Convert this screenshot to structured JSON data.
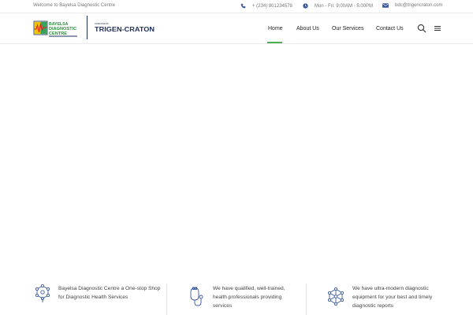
{
  "topbar": {
    "welcome": "Welcome to Bayelsa Diagnostic Centre",
    "phone": "+ (234) 801234578",
    "hours": "Mon - Fri: 9:00AM - 5:00PM",
    "email": "bdc@trigencraton.com"
  },
  "logo": {
    "bdc_line1": "BAYELSA",
    "bdc_line2": "DIAGNOSTIC",
    "bdc_line3": "CENTRE",
    "trigen_small": "OPERATED BY",
    "trigen_name": "TRIGEN-CRATON"
  },
  "nav": {
    "items": [
      "Home",
      "About Us",
      "Our Services",
      "Contact Us"
    ],
    "active": "Home"
  },
  "features": [
    {
      "icon": "molecule-icon",
      "text": "Bayelsa Diagnostic Centre a One-stop Shop for Diagnostic Health Services"
    },
    {
      "icon": "stethoscope-icon",
      "text": "We have qualified, well-trained, health professionals providing services"
    },
    {
      "icon": "network-icon",
      "text": "We have ultra-modern diagnostic equipment for your best and timely diagnostic reports"
    }
  ],
  "colors": {
    "accent": "#4caf50",
    "brand_navy": "#1f2f5a",
    "icon_blue": "#3a5a9c"
  }
}
